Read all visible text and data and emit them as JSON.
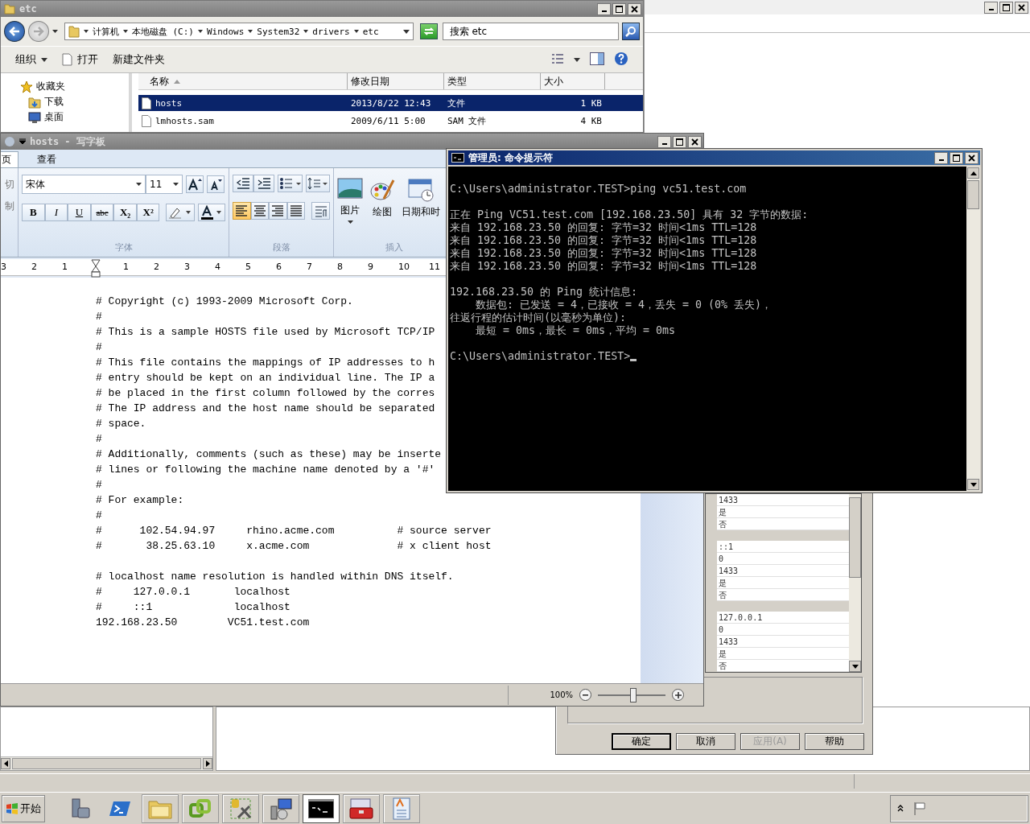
{
  "explorer": {
    "title": "etc",
    "breadcrumbs": [
      "计算机",
      "本地磁盘 (C:)",
      "Windows",
      "System32",
      "drivers",
      "etc"
    ],
    "search": {
      "placeholder": "搜索 etc"
    },
    "toolbar": [
      {
        "label": "组织",
        "kind": "menu"
      },
      {
        "label": "打开",
        "kind": "open"
      },
      {
        "label": "新建文件夹",
        "kind": "plain"
      }
    ],
    "nav_items": [
      {
        "label": "收藏夹",
        "kind": "star"
      },
      {
        "label": "下载",
        "kind": "download"
      },
      {
        "label": "桌面",
        "kind": "desktop"
      }
    ],
    "columns": [
      "名称",
      "修改日期",
      "类型",
      "大小"
    ],
    "files": [
      {
        "name": "hosts",
        "modified": "2013/8/22 12:43",
        "type": "文件",
        "size": "1 KB",
        "selected": true
      },
      {
        "name": "lmhosts.sam",
        "modified": "2009/6/11 5:00",
        "type": "SAM 文件",
        "size": "4 KB",
        "selected": false
      }
    ]
  },
  "wordpad": {
    "title": "hosts - 写字板",
    "tabs": [
      {
        "label": "页",
        "selected": true
      },
      {
        "label": "查看",
        "selected": false
      }
    ],
    "clipboard": [
      "切",
      "制"
    ],
    "font": {
      "name": "宋体",
      "size": "11"
    },
    "format_buttons": [
      {
        "label": "B",
        "kind": "bold"
      },
      {
        "label": "I",
        "kind": "italic"
      },
      {
        "label": "U",
        "kind": "underline"
      },
      {
        "label": "abc",
        "kind": "strike"
      },
      {
        "label": "X₂",
        "kind": "sub"
      },
      {
        "label": "X²",
        "kind": "sup"
      }
    ],
    "align": [
      {
        "kind": "left",
        "selected": true
      },
      {
        "kind": "center",
        "selected": false
      },
      {
        "kind": "right",
        "selected": false
      },
      {
        "kind": "justify",
        "selected": false
      }
    ],
    "insert": [
      {
        "label": "图片",
        "kind": "picture"
      },
      {
        "label": "绘图",
        "kind": "paint"
      },
      {
        "label": "日期和时",
        "kind": "datetime"
      }
    ],
    "groups": [
      "字体",
      "段落",
      "插入"
    ],
    "ruler": [
      "3",
      "2",
      "1",
      "1",
      "2",
      "3",
      "4",
      "5",
      "6",
      "7",
      "8",
      "9",
      "10",
      "11"
    ],
    "paragraphs": [
      [
        "# Copyright (c) 1993-2009 Microsoft Corp.",
        "#",
        "# This is a sample HOSTS file used by Microsoft TCP/IP",
        "#",
        "# This file contains the mappings of IP addresses to h",
        "# entry should be kept on an individual line. The IP a",
        "# be placed in the first column followed by the corres",
        "# The IP address and the host name should be separated",
        "# space.",
        "#",
        "# Additionally, comments (such as these) may be inserte",
        "# lines or following the machine name denoted by a '#'",
        "#",
        "# For example:",
        "#",
        "#      102.54.94.97     rhino.acme.com          # source server",
        "#       38.25.63.10     x.acme.com              # x client host"
      ],
      [
        "# localhost name resolution is handled within DNS itself.",
        "#     127.0.0.1       localhost",
        "#     ::1             localhost",
        "192.168.23.50        VC51.test.com"
      ]
    ],
    "zoom": {
      "reading": "100%",
      "level": 0.52
    }
  },
  "cmd": {
    "title": "管理员: 命令提示符",
    "blocks": [
      [
        "C:\\Users\\administrator.TEST>ping vc51.test.com"
      ],
      [
        "正在 Ping VC51.test.com [192.168.23.50] 具有 32 字节的数据:",
        "来自 192.168.23.50 的回复: 字节=32 时间<1ms TTL=128",
        "来自 192.168.23.50 的回复: 字节=32 时间<1ms TTL=128",
        "来自 192.168.23.50 的回复: 字节=32 时间<1ms TTL=128",
        "来自 192.168.23.50 的回复: 字节=32 时间<1ms TTL=128"
      ],
      [
        "192.168.23.50 的 Ping 统计信息:",
        "    数据包: 已发送 = 4，已接收 = 4，丢失 = 0 (0% 丢失)，",
        "往返行程的估计时间(以毫秒为单位):",
        "    最短 = 0ms，最长 = 0ms，平均 = 0ms"
      ],
      [
        "C:\\Users\\administrator.TEST>"
      ]
    ]
  },
  "dialog": {
    "rows": [
      {
        "kind": "value",
        "text": "1433"
      },
      {
        "kind": "value",
        "text": "是"
      },
      {
        "kind": "value",
        "text": "否"
      },
      {
        "kind": "group"
      },
      {
        "kind": "value",
        "text": "::1"
      },
      {
        "kind": "value",
        "text": "0"
      },
      {
        "kind": "value",
        "text": "1433"
      },
      {
        "kind": "value",
        "text": "是"
      },
      {
        "kind": "value",
        "text": "否"
      },
      {
        "kind": "group"
      },
      {
        "kind": "value",
        "text": "127.0.0.1"
      },
      {
        "kind": "value",
        "text": "0"
      },
      {
        "kind": "value",
        "text": "1433"
      },
      {
        "kind": "value",
        "text": "是"
      },
      {
        "kind": "value",
        "text": "否"
      }
    ],
    "buttons": [
      {
        "label": "确定",
        "default": true,
        "disabled": false
      },
      {
        "label": "取消",
        "default": false,
        "disabled": false
      },
      {
        "label": "应用(A)",
        "default": false,
        "disabled": true
      },
      {
        "label": "帮助",
        "default": false,
        "disabled": false
      }
    ]
  },
  "taskbar": {
    "start": "开始",
    "apps": [
      {
        "kind": "server",
        "selected": false
      },
      {
        "kind": "powershell",
        "selected": false
      },
      {
        "kind": "folder",
        "selected": false
      },
      {
        "kind": "vsphere",
        "selected": false
      },
      {
        "kind": "tools",
        "selected": false
      },
      {
        "kind": "setup",
        "selected": false
      },
      {
        "kind": "cmd",
        "selected": true
      },
      {
        "kind": "toolbox",
        "selected": false
      },
      {
        "kind": "wordpad",
        "selected": false
      }
    ]
  }
}
